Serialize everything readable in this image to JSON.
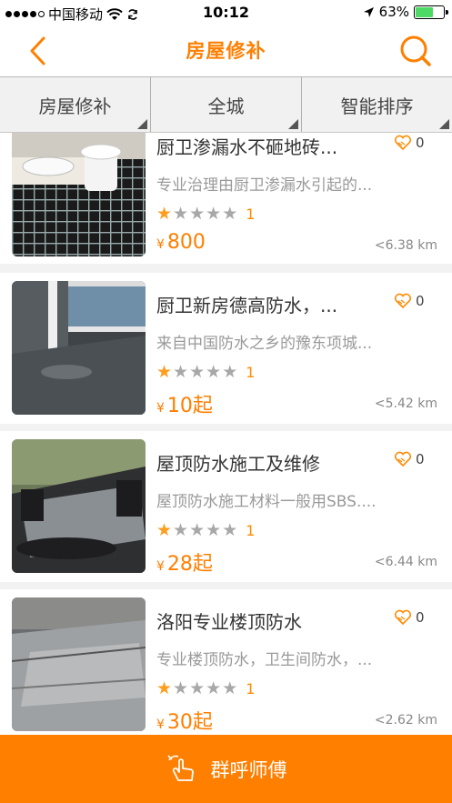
{
  "status_bar": {
    "carrier": "中国移动",
    "time": "10:12",
    "battery_percent": "63%",
    "battery_level": 0.63
  },
  "nav": {
    "title": "房屋修补",
    "back_icon": "chevron-left-icon",
    "search_icon": "search-icon"
  },
  "filters": [
    {
      "label": "房屋修补"
    },
    {
      "label": "全城"
    },
    {
      "label": "智能排序"
    }
  ],
  "listings": [
    {
      "title": "厨卫渗漏水不砸地砖...",
      "favorites": "0",
      "desc": "专业治理由厨卫渗漏水引起的...",
      "stars": 1,
      "rating_count": "1",
      "currency": "¥",
      "price": "800",
      "distance": "<6.38 km"
    },
    {
      "title": "厨卫新房德高防水，...",
      "favorites": "0",
      "desc": "来自中国防水之乡的豫东项城...",
      "stars": 1,
      "rating_count": "1",
      "currency": "¥",
      "price": "10起",
      "distance": "<5.42 km"
    },
    {
      "title": "屋顶防水施工及维修",
      "favorites": "0",
      "desc": "屋顶防水施工材料一般用SBS....",
      "stars": 1,
      "rating_count": "1",
      "currency": "¥",
      "price": "28起",
      "distance": "<6.44 km"
    },
    {
      "title": "洛阳专业楼顶防水",
      "favorites": "0",
      "desc": "专业楼顶防水，卫生间防水，...",
      "stars": 1,
      "rating_count": "1",
      "currency": "¥",
      "price": "30起",
      "distance": "<2.62 km"
    }
  ],
  "call_button": {
    "label": "群呼师傅",
    "icon": "tap-hand-icon"
  },
  "colors": {
    "accent": "#ff7f00",
    "star_on": "#ff9d1e",
    "star_off": "#a8a8a8"
  }
}
